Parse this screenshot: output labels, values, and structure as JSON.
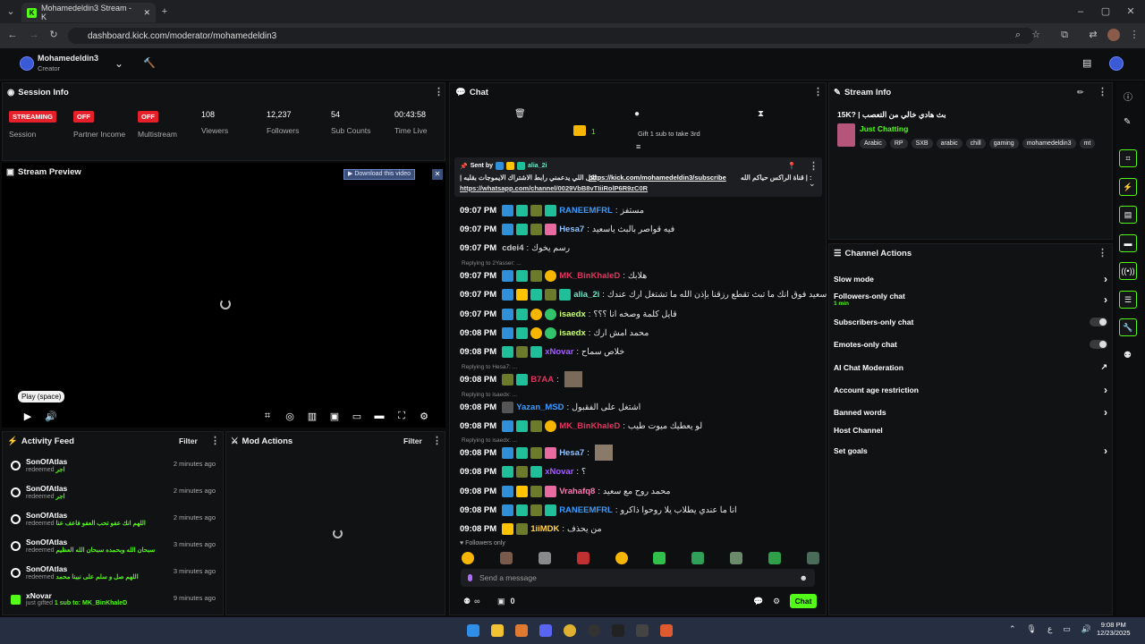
{
  "browser": {
    "tab_title": "Mohamedeldin3 Stream - K",
    "url": "dashboard.kick.com/moderator/mohamedeldin3"
  },
  "header": {
    "channel_name": "Mohamedeldin3",
    "role": "Creator"
  },
  "session": {
    "title": "Session Info",
    "stats": [
      {
        "value": "STREAMING",
        "label": "Session"
      },
      {
        "value": "OFF",
        "label": "Partner Income"
      },
      {
        "value": "OFF",
        "label": "Multistream"
      },
      {
        "value": "108",
        "label": "Viewers"
      },
      {
        "value": "12,237",
        "label": "Followers"
      },
      {
        "value": "54",
        "label": "Sub Counts"
      },
      {
        "value": "00:43:58",
        "label": "Time Live"
      }
    ]
  },
  "preview": {
    "title": "Stream Preview",
    "download_label": "Download this video",
    "tooltip": "Play (space)"
  },
  "activity": {
    "title": "Activity Feed",
    "filter_label": "Filter",
    "items": [
      {
        "name": "SonOfAtlas",
        "action": "redeemed",
        "detail": "اجر",
        "time": "2 minutes ago"
      },
      {
        "name": "SonOfAtlas",
        "action": "redeemed",
        "detail": "اجر",
        "time": "2 minutes ago"
      },
      {
        "name": "SonOfAtlas",
        "action": "redeemed",
        "detail": "اللهم انك عفو تحب العفو فاعف عنا",
        "time": "2 minutes ago"
      },
      {
        "name": "SonOfAtlas",
        "action": "redeemed",
        "detail": "سبحان الله وبحمده سبحان الله العظيم",
        "time": "3 minutes ago"
      },
      {
        "name": "SonOfAtlas",
        "action": "redeemed",
        "detail": "اللهم صل و سلم على نبينا محمد",
        "time": "3 minutes ago"
      },
      {
        "name": "xNovar",
        "action": "just gifted",
        "detail": "1 sub to: MK_BinKhaleD",
        "time": "9 minutes ago"
      }
    ]
  },
  "mod_actions": {
    "title": "Mod Actions",
    "filter_label": "Filter"
  },
  "chat": {
    "title": "Chat",
    "gift_text": "Gift 1 sub to take 3rd",
    "gift_count": "1",
    "pinned": {
      "sent_by": "Sent by",
      "sender": "alia_2i",
      "line1_ar": "قناة الراكس حياكم الله | :",
      "link1": "https://kick.com/mohamedeldin3/subscribe",
      "line1_tail": "| لكل اللي يدعمني رابط الاشتراك الايموجات بقلبه",
      "link2": "https://whatsapp.com/channel/0029VbB8vTIiiRolP6R9zC0R"
    },
    "messages": [
      {
        "time": "09:07 PM",
        "user": "RANEEMFRL",
        "color": "#3a9bff",
        "text": "مستفز",
        "reply": ""
      },
      {
        "time": "09:07 PM",
        "user": "Hesa7",
        "color": "#8ec1ff",
        "text": "فيه قواصر بالبث ياسعيد",
        "reply": ""
      },
      {
        "time": "09:07 PM",
        "user": "cdei4",
        "color": "#c9c9c9",
        "text": "رسم يخوك",
        "reply": ""
      },
      {
        "time": "09:07 PM",
        "user": "MK_BinKhaleD",
        "color": "#e0345e",
        "text": "هلابك",
        "reply": "Replying to 2Yasser: ..."
      },
      {
        "time": "09:07 PM",
        "user": "alia_2i",
        "color": "#6ee7c8",
        "text": "سعيد فوق انك ما تبث تقطع رزقنا بإذن الله ما تشتغل ارك عندك",
        "reply": ""
      },
      {
        "time": "09:07 PM",
        "user": "isaedx",
        "color": "#c7ff6a",
        "text": "قايل كلمة وصخه انا ؟؟؟",
        "reply": ""
      },
      {
        "time": "09:08 PM",
        "user": "isaedx",
        "color": "#c7ff6a",
        "text": "محمد امش ارك",
        "reply": ""
      },
      {
        "time": "09:08 PM",
        "user": "xNovar",
        "color": "#a45cff",
        "text": "خلاص سماح",
        "reply": ""
      },
      {
        "time": "09:08 PM",
        "user": "B7AA",
        "color": "#e0345e",
        "text": "",
        "reply": "Replying to Hesa7: ..."
      },
      {
        "time": "09:08 PM",
        "user": "Yazan_MSD",
        "color": "#3a9bff",
        "text": "اشتغل على الفقبول",
        "reply": "Replying to isaedx: ..."
      },
      {
        "time": "09:08 PM",
        "user": "MK_BinKhaleD",
        "color": "#e0345e",
        "text": "لو يعطيك ميوت طيب",
        "reply": ""
      },
      {
        "time": "09:08 PM",
        "user": "Hesa7",
        "color": "#8ec1ff",
        "text": "",
        "reply": "Replying to isaedx: ..."
      },
      {
        "time": "09:08 PM",
        "user": "xNovar",
        "color": "#a45cff",
        "text": "؟",
        "reply": ""
      },
      {
        "time": "09:08 PM",
        "user": "Vrahafq8",
        "color": "#ff7ab6",
        "text": "محمد روح مع سعيد",
        "reply": ""
      },
      {
        "time": "09:08 PM",
        "user": "RANEEMFRL",
        "color": "#3a9bff",
        "text": "انا ما عندي يطلاب يلا روحوا ذاكرو",
        "reply": ""
      },
      {
        "time": "09:08 PM",
        "user": "1iiMDK",
        "color": "#ffd24a",
        "text": "من يحذف",
        "reply": ""
      }
    ],
    "followers_only": "Followers only",
    "input_placeholder": "Send a message",
    "points": "0",
    "send_label": "Chat"
  },
  "stream_info": {
    "title": "Stream Info",
    "stream_title": "15K? | بث هادي خالي من التعصب",
    "category": "Just Chatting",
    "tags": [
      "Arabic",
      "RP",
      "SXB",
      "arabic",
      "chill",
      "gaming",
      "mohamedeldin3",
      "mt"
    ]
  },
  "channel_actions": {
    "title": "Channel Actions",
    "items": [
      {
        "label": "Slow mode",
        "sub": "",
        "control": "chevron"
      },
      {
        "label": "Followers-only chat",
        "sub": "1 min",
        "control": "chevron"
      },
      {
        "label": "Subscribers-only chat",
        "sub": "",
        "control": "toggle"
      },
      {
        "label": "Emotes-only chat",
        "sub": "",
        "control": "toggle"
      },
      {
        "label": "AI Chat Moderation",
        "sub": "",
        "control": "external"
      },
      {
        "label": "Account age restriction",
        "sub": "",
        "control": "chevron"
      },
      {
        "label": "Banned words",
        "sub": "",
        "control": "chevron"
      },
      {
        "label": "Host Channel",
        "sub": "",
        "control": "none"
      },
      {
        "label": "Set goals",
        "sub": "",
        "control": "chevron"
      }
    ]
  },
  "taskbar": {
    "time": "9:08 PM",
    "date": "12/23/2025"
  },
  "colors": {
    "accent": "#53fc18",
    "danger": "#e5202a",
    "background": "#0b0b0c"
  }
}
